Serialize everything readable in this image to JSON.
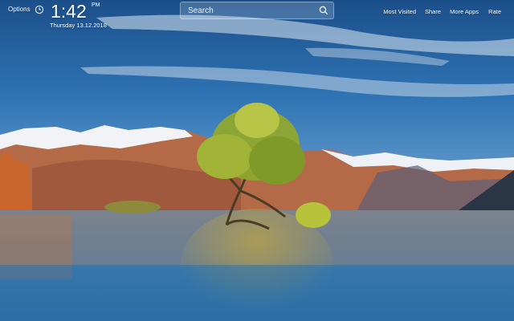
{
  "header": {
    "options_label": "Options",
    "time": "1:42",
    "meridiem": "PM",
    "date": "Thursday  13.12.2018"
  },
  "search": {
    "placeholder": "Search"
  },
  "nav": {
    "items": [
      {
        "label": "Most Visited"
      },
      {
        "label": "Share"
      },
      {
        "label": "More Apps"
      },
      {
        "label": "Rate"
      }
    ]
  },
  "icons": {
    "clock": "clock-icon",
    "search": "search-icon"
  },
  "colors": {
    "text": "#ffffff",
    "sky_top": "#1f5c9a",
    "lake": "#3a7aaa"
  }
}
